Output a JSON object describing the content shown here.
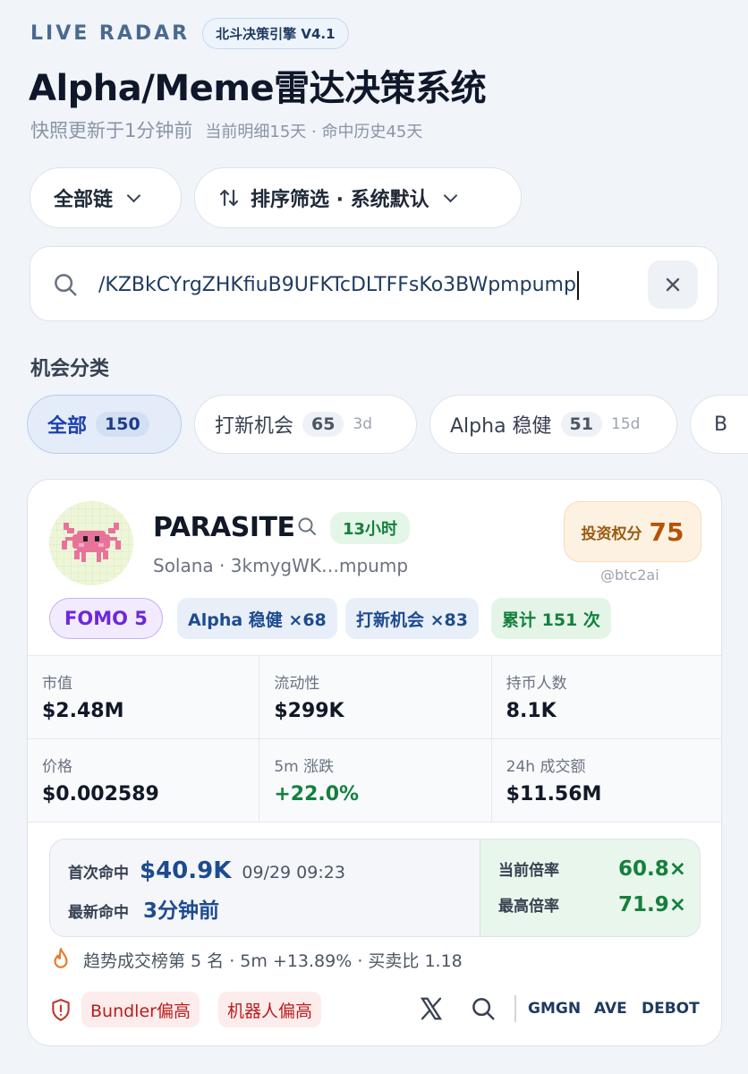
{
  "header": {
    "kicker": "LIVE RADAR",
    "engine_badge": "北斗决策引擎 V4.1",
    "title": "Alpha/Meme雷达决策系统",
    "snapshot": "快照更新于1分钟前",
    "meta": "当前明细15天 · 命中历史45天"
  },
  "filters": {
    "chain": "全部链",
    "sort": "排序筛选 · 系统默认"
  },
  "search": {
    "value": "/KZBkCYrgZHKfiuB9UFKTcDLTFFsKo3BWpmpump"
  },
  "categories": {
    "label": "机会分类",
    "items": [
      {
        "label": "全部",
        "count": "150",
        "days": ""
      },
      {
        "label": "打新机会",
        "count": "65",
        "days": "3d"
      },
      {
        "label": "Alpha 稳健",
        "count": "51",
        "days": "15d"
      },
      {
        "label": "B",
        "count": "",
        "days": ""
      }
    ]
  },
  "token": {
    "name": "PARASITE",
    "age": "13小时",
    "chain": "Solana",
    "address": "3kmygWK…mpump",
    "score_label": "投资权分",
    "score": "75",
    "handle": "@btc2ai",
    "tags": {
      "fomo": "FOMO 5",
      "alpha": "Alpha 稳健 ×68",
      "launch": "打新机会 ×83",
      "total": "累计 151 次"
    },
    "metrics": [
      {
        "label": "市值",
        "value": "$2.48M"
      },
      {
        "label": "流动性",
        "value": "$299K"
      },
      {
        "label": "持币人数",
        "value": "8.1K"
      },
      {
        "label": "价格",
        "value": "$0.002589"
      },
      {
        "label": "5m 涨跌",
        "value": "+22.0%"
      },
      {
        "label": "24h 成交额",
        "value": "$11.56M"
      }
    ],
    "hits": {
      "first_label": "首次命中",
      "first_value": "$40.9K",
      "first_time": "09/29 09:23",
      "latest_label": "最新命中",
      "latest_value": "3分钟前",
      "current_label": "当前倍率",
      "current_value": "60.8×",
      "max_label": "最高倍率",
      "max_value": "71.9×"
    },
    "trend": "趋势成交榜第 5 名 · 5m +13.89% · 买卖比 1.18",
    "risks": [
      "Bundler偏高",
      "机器人偏高"
    ],
    "links": [
      "GMGN",
      "AVE",
      "DEBOT"
    ]
  },
  "colors": {
    "accent_blue": "#1e4b8f",
    "positive_green": "#15803d",
    "score_orange": "#b45309",
    "risk_red": "#b91c1c"
  }
}
